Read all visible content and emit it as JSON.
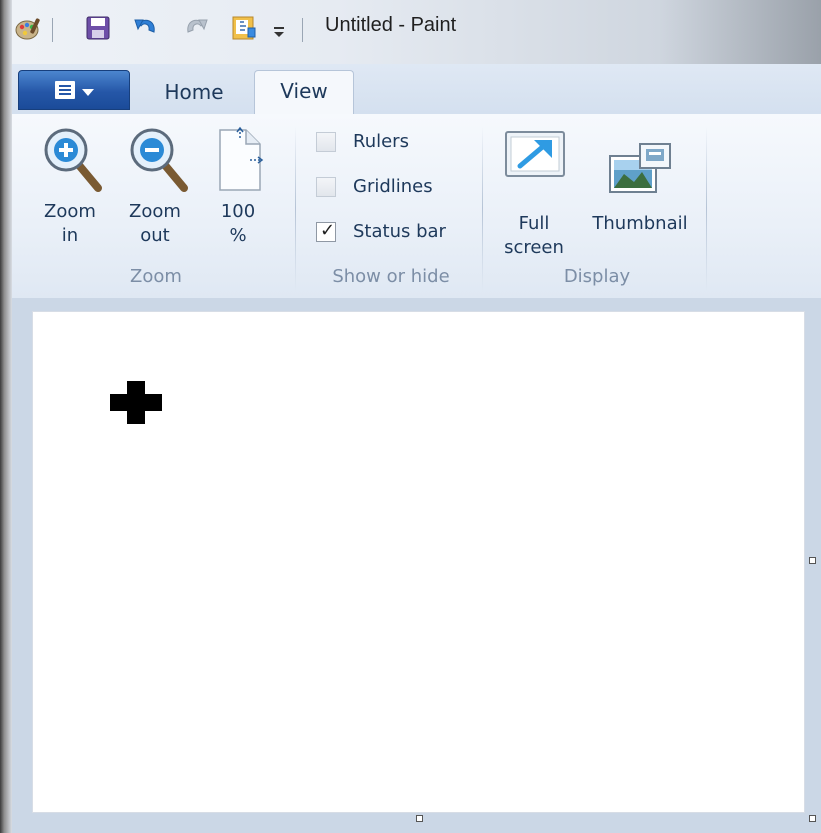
{
  "window": {
    "title": "Untitled - Paint"
  },
  "quick_access_toolbar": {
    "icons": [
      "paint-app-icon",
      "save-icon",
      "undo-icon",
      "redo-icon",
      "properties-icon",
      "customize-dropdown-icon"
    ]
  },
  "ribbon": {
    "tabs": [
      "Home",
      "View"
    ],
    "active_tab": "View",
    "groups": {
      "zoom": {
        "label": "Zoom",
        "buttons": {
          "zoom_in": "Zoom\nin",
          "zoom_out": "Zoom\nout",
          "hundred_percent": "100\n%"
        }
      },
      "show_or_hide": {
        "label": "Show or hide",
        "checkboxes": [
          {
            "label": "Rulers",
            "checked": false
          },
          {
            "label": "Gridlines",
            "checked": false
          },
          {
            "label": "Status bar",
            "checked": true
          }
        ]
      },
      "display": {
        "label": "Display",
        "buttons": {
          "full_screen": "Full\nscreen",
          "thumbnail": "Thumbnail"
        }
      }
    }
  },
  "colors": {
    "app_menu_blue": "#2557a8",
    "ribbon_text": "#1e395b",
    "group_label": "#7c8ea6",
    "workspace": "#cbd7e6",
    "canvas": "#ffffff",
    "cursor": "#000000"
  },
  "canvas": {
    "cursor_icon": "crosshair-cursor-icon"
  }
}
